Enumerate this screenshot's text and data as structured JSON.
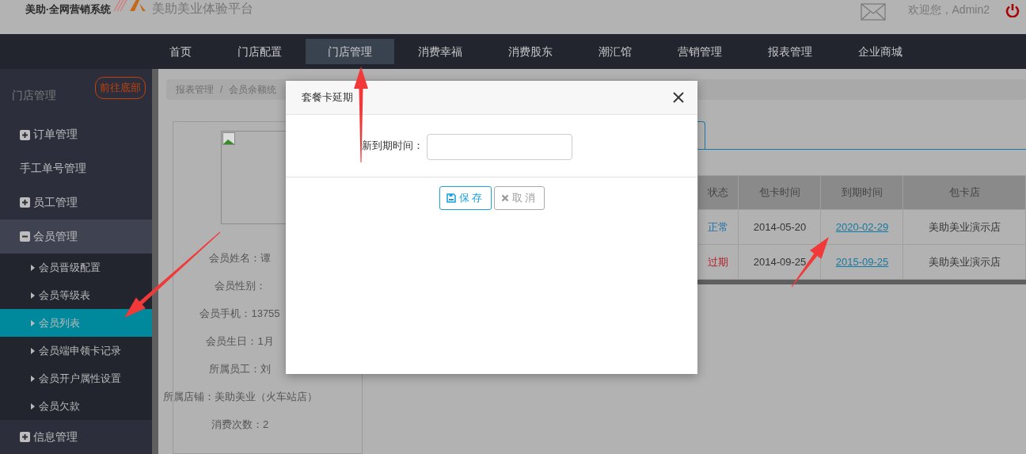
{
  "header": {
    "brand": "美助·全网营销系统",
    "platform": "美助美业体验平台",
    "welcome": "欢迎您，Admin2"
  },
  "nav": [
    {
      "label": "首页",
      "selected": false
    },
    {
      "label": "门店配置",
      "selected": false
    },
    {
      "label": "门店管理",
      "selected": true
    },
    {
      "label": "消费幸福",
      "selected": false
    },
    {
      "label": "消费股东",
      "selected": false
    },
    {
      "label": "潮汇馆",
      "selected": false
    },
    {
      "label": "营销管理",
      "selected": false
    },
    {
      "label": "报表管理",
      "selected": false
    },
    {
      "label": "企业商城",
      "selected": false
    }
  ],
  "sidebar": {
    "title": "门店管理",
    "jump_button": "前往底部",
    "items": [
      {
        "label": "订单管理",
        "kind": "group",
        "expanded": false
      },
      {
        "label": "手工单号管理",
        "kind": "link"
      },
      {
        "label": "员工管理",
        "kind": "group",
        "expanded": false
      },
      {
        "label": "会员管理",
        "kind": "group",
        "expanded": true,
        "children": [
          {
            "label": "会员晋级配置",
            "selected": false
          },
          {
            "label": "会员等级表",
            "selected": false
          },
          {
            "label": "会员列表",
            "selected": true
          },
          {
            "label": "会员端申领卡记录",
            "selected": false
          },
          {
            "label": "会员开户属性设置",
            "selected": false
          },
          {
            "label": "会员欠款",
            "selected": false
          }
        ]
      },
      {
        "label": "信息管理",
        "kind": "group",
        "expanded": false
      }
    ]
  },
  "breadcrumb": {
    "separator": "/",
    "items": [
      "报表管理",
      "会员余额统"
    ]
  },
  "member": {
    "fields": [
      "会员姓名：谭",
      "会员性别：",
      "会员手机：13755",
      "会员生日：1月",
      "所属员工：刘",
      "所属店铺：美助美业（火车站店）",
      "消费次数：2"
    ]
  },
  "table": {
    "columns": [
      "状态",
      "包卡时间",
      "到期时间",
      "包卡店"
    ],
    "rows": [
      {
        "status": "正常",
        "expired": false,
        "start": "2014-05-20",
        "expiry": "2020-02-29",
        "store": "美助美业演示店"
      },
      {
        "status": "过期",
        "expired": true,
        "start": "2014-09-25",
        "expiry": "2015-09-25",
        "store": "美助美业演示店"
      }
    ]
  },
  "modal": {
    "title": "套餐卡延期",
    "field_label": "新到期时间：",
    "buttons": [
      {
        "label": "保存",
        "kind": "primary"
      },
      {
        "label": "取消",
        "kind": "cancel"
      }
    ]
  }
}
